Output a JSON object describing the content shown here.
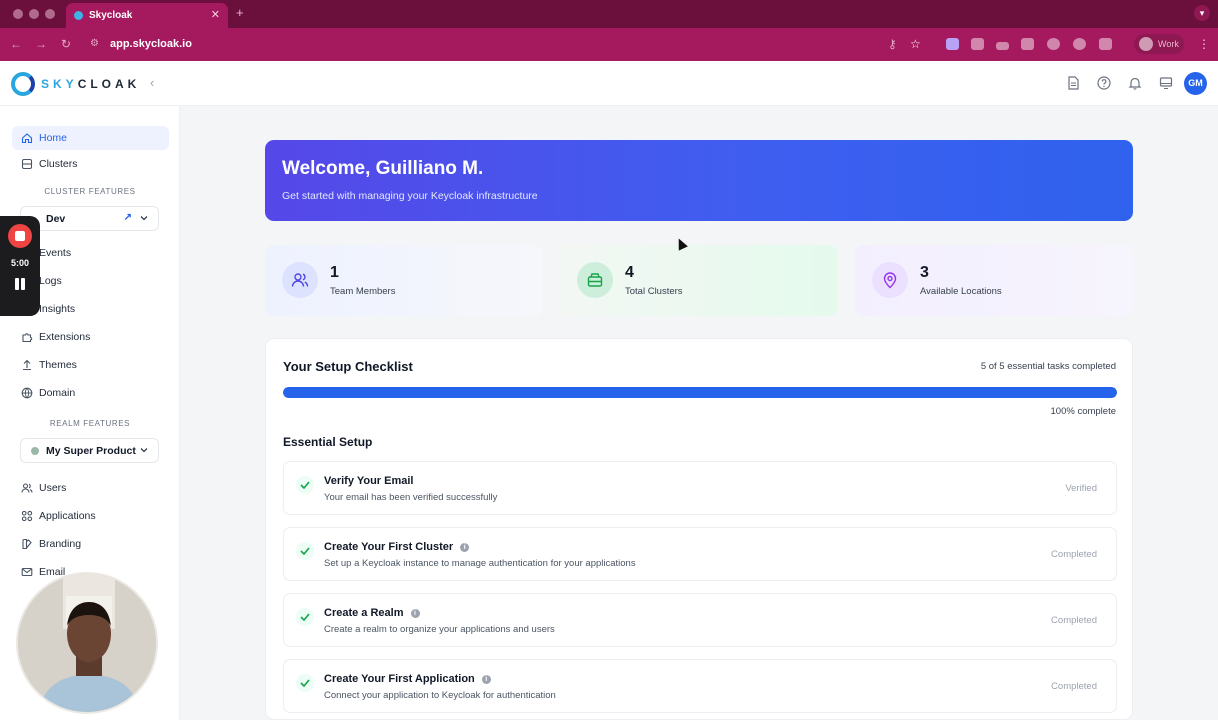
{
  "browser": {
    "tab_title": "Skycloak",
    "url": "app.skycloak.io",
    "profile_label": "Work"
  },
  "app": {
    "logo_text_prefix": "SKY",
    "logo_text_suffix": "CLOAK",
    "avatar_initials": "GM",
    "accent_color": "#2563eb"
  },
  "sidebar": {
    "home": "Home",
    "clusters": "Clusters",
    "cluster_features_label": "CLUSTER FEATURES",
    "cluster_select": "Dev",
    "events": "Events",
    "logs": "Logs",
    "insights": "Insights",
    "extensions": "Extensions",
    "themes": "Themes",
    "domain": "Domain",
    "realm_features_label": "REALM FEATURES",
    "realm_select": "My Super Product",
    "users": "Users",
    "applications": "Applications",
    "branding": "Branding",
    "email": "Email"
  },
  "recorder": {
    "time": "5:00"
  },
  "welcome": {
    "title": "Welcome, Guilliano M.",
    "subtitle": "Get started with managing your Keycloak infrastructure"
  },
  "stats": [
    {
      "value": "1",
      "label": "Team Members"
    },
    {
      "value": "4",
      "label": "Total Clusters"
    },
    {
      "value": "3",
      "label": "Available Locations"
    }
  ],
  "checklist": {
    "title": "Your Setup Checklist",
    "tasks_completed": "5 of 5 essential tasks completed",
    "progress_percent": 100,
    "progress_label": "100% complete",
    "section_title": "Essential Setup",
    "tasks": [
      {
        "title": "Verify Your Email",
        "desc": "Your email has been verified successfully",
        "status": "Verified"
      },
      {
        "title": "Create Your First Cluster",
        "desc": "Set up a Keycloak instance to manage authentication for your applications",
        "status": "Completed"
      },
      {
        "title": "Create a Realm",
        "desc": "Create a realm to organize your applications and users",
        "status": "Completed"
      },
      {
        "title": "Create Your First Application",
        "desc": "Connect your application to Keycloak for authentication",
        "status": "Completed"
      }
    ]
  }
}
